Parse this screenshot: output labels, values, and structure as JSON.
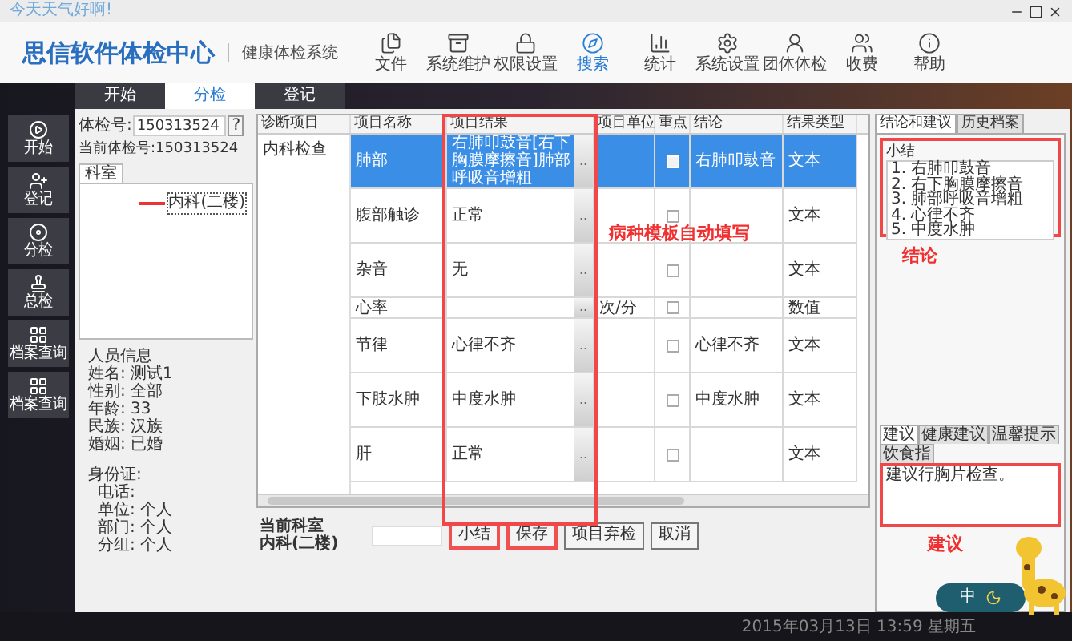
{
  "window": {
    "title": "今天天气好啊!"
  },
  "header": {
    "logo": "思信软件体检中心",
    "subtitle": "健康体检系统"
  },
  "toolbar": [
    {
      "label": "文件",
      "selected": false
    },
    {
      "label": "系统维护",
      "selected": false
    },
    {
      "label": "权限设置",
      "selected": false
    },
    {
      "label": "搜索",
      "selected": true
    },
    {
      "label": "统计",
      "selected": false
    },
    {
      "label": "系统设置",
      "selected": false
    },
    {
      "label": "团体体检",
      "selected": false
    },
    {
      "label": "收费",
      "selected": false
    },
    {
      "label": "帮助",
      "selected": false
    }
  ],
  "tabs": [
    {
      "label": "开始",
      "selected": false
    },
    {
      "label": "分检",
      "selected": true
    },
    {
      "label": "登记",
      "selected": false
    }
  ],
  "sidebar": [
    {
      "label": "开始"
    },
    {
      "label": "登记"
    },
    {
      "label": "分检"
    },
    {
      "label": "总检"
    },
    {
      "label": "档案查询"
    },
    {
      "label": "档案查询"
    }
  ],
  "info": {
    "exam_label": "体检号:",
    "exam_value": "150313524",
    "help": "?",
    "current_label": "当前体检号:",
    "current_value": "150313524",
    "dept_tab": "科室",
    "dept_items": [
      {
        "label": "内科(二楼)",
        "selected": true
      }
    ],
    "person_title": "人员信息",
    "person": [
      "姓名: 测试1",
      "性别: 全部",
      "年龄: 33",
      "民族: 汉族",
      "婚姻: 已婚"
    ],
    "contact": [
      "身份证:",
      "电话:",
      "单位: 个人",
      "部门: 个人",
      "分组: 个人"
    ]
  },
  "table": {
    "columns": [
      "诊断项目",
      "项目名称",
      "项目结果",
      "项目单位",
      "重点",
      "结论",
      "结果类型"
    ],
    "group": "内科检查",
    "picker": "..",
    "rows": [
      {
        "name": "肺部",
        "result": "右肺叩鼓音[右下胸膜摩擦音]肺部呼吸音增粗",
        "unit": "",
        "checked": true,
        "conclusion": "右肺叩鼓音",
        "type": "文本",
        "selected": true,
        "kind": "tall"
      },
      {
        "name": "腹部触诊",
        "result": "正常",
        "unit": "",
        "checked": false,
        "conclusion": "",
        "type": "文本",
        "selected": false,
        "kind": "tall"
      },
      {
        "name": "杂音",
        "result": "无",
        "unit": "",
        "checked": false,
        "conclusion": "",
        "type": "文本",
        "selected": false,
        "kind": "tall"
      },
      {
        "name": "心率",
        "result": "",
        "unit": "次/分",
        "checked": false,
        "conclusion": "",
        "type": "数值",
        "selected": false,
        "kind": "short"
      },
      {
        "name": "节律",
        "result": "心律不齐",
        "unit": "",
        "checked": false,
        "conclusion": "心律不齐",
        "type": "文本",
        "selected": false,
        "kind": "tall"
      },
      {
        "name": "下肢水肿",
        "result": "中度水肿",
        "unit": "",
        "checked": false,
        "conclusion": "中度水肿",
        "type": "文本",
        "selected": false,
        "kind": "tall"
      },
      {
        "name": "肝",
        "result": "正常",
        "unit": "",
        "checked": false,
        "conclusion": "",
        "type": "文本",
        "selected": false,
        "kind": "tall"
      }
    ]
  },
  "annotation": "病种模板自动填写",
  "footer": {
    "dept_label": "当前科室",
    "dept_value": "内科(二楼)",
    "buttons": [
      {
        "label": "小结",
        "marked": true
      },
      {
        "label": "保存",
        "marked": true
      },
      {
        "label": "项目弃检",
        "marked": false
      },
      {
        "label": "取消",
        "marked": false
      }
    ]
  },
  "right": {
    "tabs": [
      {
        "label": "结论和建议",
        "selected": true
      },
      {
        "label": "历史档案",
        "selected": false
      }
    ],
    "summary_title": "小结",
    "summary": [
      "1. 右肺叩鼓音",
      "2. 右下胸膜摩擦音",
      "3. 肺部呼吸音增粗",
      "4. 心律不齐",
      "5. 中度水肿"
    ],
    "summary_note": "结论",
    "advice_tabs": [
      {
        "label": "建议",
        "selected": true
      },
      {
        "label": "健康建议",
        "selected": false
      },
      {
        "label": "温馨提示",
        "selected": false
      },
      {
        "label": "饮食指",
        "selected": false
      }
    ],
    "advice": "建议行胸片检查。",
    "advice_note": "建议"
  },
  "ime": {
    "label": "中"
  },
  "status_bar": "2015年03月13日 13:59 星期五"
}
